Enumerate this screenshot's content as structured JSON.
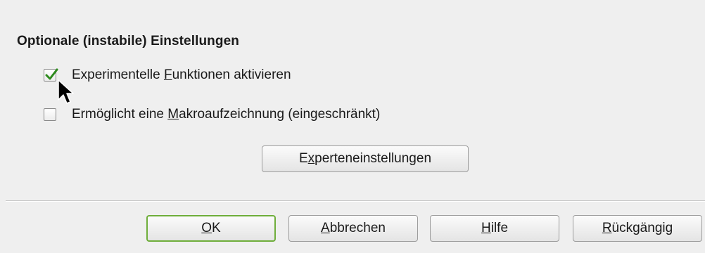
{
  "section": {
    "title": "Optionale (instabile) Einstellungen"
  },
  "options": [
    {
      "pre": "Experimentelle ",
      "mnemonic": "F",
      "post": "unktionen aktivieren",
      "checked": true
    },
    {
      "pre": "Ermöglicht eine ",
      "mnemonic": "M",
      "post": "akroaufzeichnung (eingeschränkt)",
      "checked": false
    }
  ],
  "expert_button": {
    "pre": "E",
    "mnemonic": "x",
    "post": "perteneinstellungen"
  },
  "buttons": {
    "ok": {
      "pre": "",
      "mnemonic": "O",
      "post": "K"
    },
    "cancel": {
      "pre": "",
      "mnemonic": "A",
      "post": "bbrechen"
    },
    "help": {
      "pre": "",
      "mnemonic": "H",
      "post": "ilfe"
    },
    "undo": {
      "pre": "",
      "mnemonic": "R",
      "post": "ückgängig"
    }
  },
  "colors": {
    "check_mark": "#2e8b1e",
    "ok_border": "#6fae3b"
  },
  "icons": {
    "checkmark": "check-icon",
    "cursor": "mouse-pointer-icon"
  }
}
